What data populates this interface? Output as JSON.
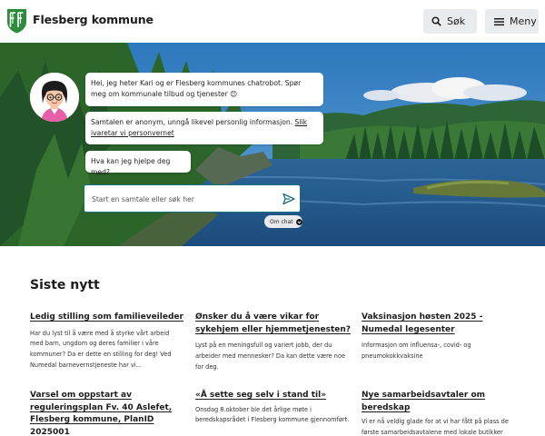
{
  "header": {
    "brand": "Flesberg kommune",
    "search_label": "Søk",
    "menu_label": "Meny"
  },
  "chatbot": {
    "messages": [
      "Hei, jeg heter Kari og er Flesberg kommunes chatrobot. Spør meg om kommunale tilbud og tjenester 😊",
      "Samtalen er anonym, unngå likevel personlig informasjon.",
      "Hva kan jeg hjelpe deg med?"
    ],
    "privacy_link": "Slik ivaretar vi personvernet",
    "input_placeholder": "Start en samtale eller søk her",
    "about_label": "Om chat"
  },
  "news": {
    "title": "Siste nytt",
    "items": [
      {
        "title": "Ledig stilling som familieveileder",
        "desc": "Har du lyst til å være med å styrke vårt arbeid med barn, ungdom og deres familier i våre kommuner? Da er dette en stilling for deg! Ved Numedal barnevernstjeneste har vi..."
      },
      {
        "title": "Ønsker du å være vikar for sykehjem eller hjemmetjenesten?",
        "desc": "Lyst på en meningsfull og variert jobb, der du arbeider med mennesker? Da kan dette være noe for deg."
      },
      {
        "title": "Vaksinasjon høsten 2025 - Numedal legesenter",
        "desc": "Informasjon om influensa-, covid- og pneumokokkvaksine"
      },
      {
        "title": "Varsel om oppstart av reguleringsplan Fv. 40 Aslefet, Flesberg kommune, PlanID 2025001",
        "desc": ""
      },
      {
        "title": "«Å sette seg selv i stand til»",
        "desc": "Onsdag 8.oktober ble det årlige møte i beredskapsrådet i Flesberg kommune gjennomført."
      },
      {
        "title": "Nye samarbeidsavtaler om beredskap",
        "desc": "Vi er nå veldig glade for at vi har fått på plass de første samarbeidsavtalene med lokale butikker"
      }
    ]
  },
  "colors": {
    "brand_green": "#2e8b3e",
    "teal_border": "#1a6e7a",
    "button_bg": "#e9ecee"
  },
  "icons": [
    "flesberg-logo",
    "search-icon",
    "hamburger-icon",
    "send-icon",
    "chevron-down-icon"
  ]
}
